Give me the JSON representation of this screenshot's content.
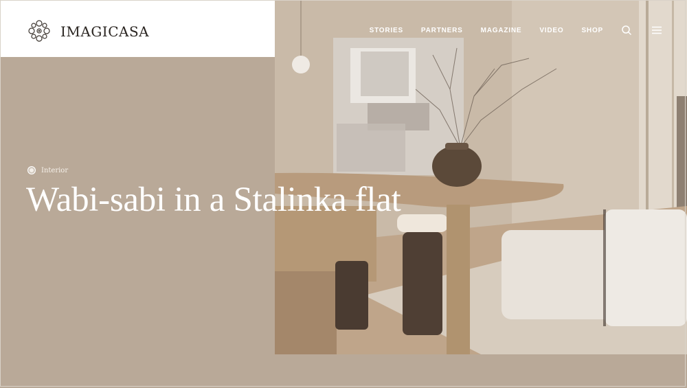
{
  "brand": {
    "name": "IMAGICASA",
    "logo_icon": "ornament-logo-icon"
  },
  "nav": {
    "items": [
      "STORIES",
      "PARTNERS",
      "MAGAZINE",
      "VIDEO",
      "SHOP"
    ],
    "search_icon": "search-icon",
    "menu_icon": "hamburger-menu-icon"
  },
  "hero": {
    "category": "Interior",
    "title": "Wabi-sabi in a Stalinka flat",
    "image": "interior-photo"
  },
  "colors": {
    "background": "#b9a998",
    "header_bg": "#ffffff",
    "text_light": "#ffffff"
  }
}
